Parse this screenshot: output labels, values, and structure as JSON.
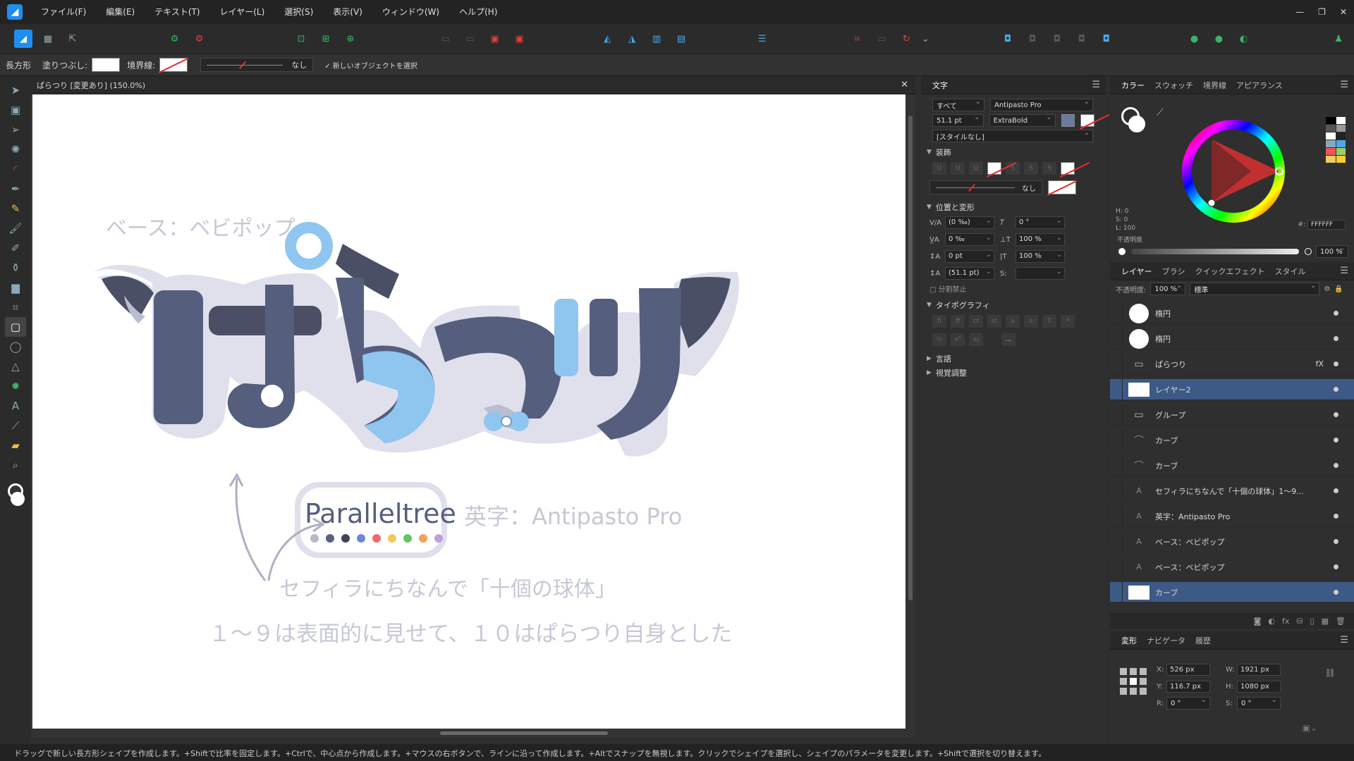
{
  "menu": {
    "items": [
      "ファイル(F)",
      "編集(E)",
      "テキスト(T)",
      "レイヤー(L)",
      "選択(S)",
      "表示(V)",
      "ウィンドウ(W)",
      "ヘルプ(H)"
    ],
    "window_controls": [
      "—",
      "❐",
      "✕"
    ]
  },
  "context_bar": {
    "tool_name": "長方形",
    "fill_label": "塗りつぶし:",
    "stroke_label": "境界線:",
    "stroke_style": "なし",
    "select_new_label": "新しいオブジェクトを選択"
  },
  "document": {
    "tab_title": "ぱらつり [変更あり] (150.0%)"
  },
  "artwork": {
    "base_font_note": "ベース：ベビポップ",
    "logo_text": "ぱらつり",
    "sublogo": "Paralleltree",
    "english_font_note": "英字：Antipasto Pro",
    "note_line1": "セフィラにちなんで「十個の球体」",
    "note_line2": "１～９は表面的に見せて、１０はぱらつり自身とした",
    "dot_colors": [
      "#b8b8cc",
      "#5a6080",
      "#3f4358",
      "#6e86d8",
      "#ef6b6b",
      "#f2c85a",
      "#66c466",
      "#f2a25a",
      "#c49be0"
    ],
    "logo_dark": "#565e7e",
    "logo_light": "#8ec6ef",
    "outline": "#dfe0ec"
  },
  "character_panel": {
    "title": "文字",
    "scope": "すべて",
    "font_family": "Antipasto Pro",
    "font_size": "51.1 pt",
    "font_weight": "ExtraBold",
    "style": "[スタイルなし]",
    "decoration_section": "装飾",
    "decoration_line": "なし",
    "position_section": "位置と変形",
    "kerning": "(0 ‰)",
    "tracking": "0 ‰",
    "baseline": "0 pt",
    "leading": "(51.1 pt)",
    "shear": "0 °",
    "scale_v": "100 %",
    "scale_h": "100 %",
    "no_break": "分割禁止",
    "typography_section": "タイポグラフィ",
    "more_btn": "...",
    "language_section": "言語",
    "visual_section": "視覚調整"
  },
  "color_panel": {
    "tabs": [
      "カラー",
      "スウォッチ",
      "境界線",
      "アピアランス"
    ],
    "h": "H: 0",
    "s": "S: 0",
    "l": "L: 100",
    "hex_label": "#:",
    "hex": "FFFFFF",
    "opacity_label": "不透明度",
    "opacity": "100 %"
  },
  "layers_panel": {
    "tabs": [
      "レイヤー",
      "ブラシ",
      "クイックエフェクト",
      "スタイル"
    ],
    "opacity_label": "不透明度:",
    "opacity": "100 %",
    "blend": "標準",
    "layers": [
      {
        "name": "楕円",
        "kind": "ellipse",
        "selected": false
      },
      {
        "name": "楕円",
        "kind": "ellipse",
        "selected": false
      },
      {
        "name": "ぱらつり",
        "kind": "folder",
        "selected": false,
        "fx": "fX"
      },
      {
        "name": "レイヤー2",
        "kind": "rect",
        "selected": true
      },
      {
        "name": "グループ",
        "kind": "folder",
        "selected": false
      },
      {
        "name": "カーブ",
        "kind": "curve",
        "selected": false
      },
      {
        "name": "カーブ",
        "kind": "curve",
        "selected": false
      },
      {
        "name": "セフィラにちなんで「十個の球体」1～9...",
        "kind": "text",
        "selected": false
      },
      {
        "name": "英字：Antipasto Pro",
        "kind": "text",
        "selected": false
      },
      {
        "name": "ベース：ベビポップ",
        "kind": "text",
        "selected": false
      },
      {
        "name": "ベース：ベビポップ",
        "kind": "text",
        "selected": false
      },
      {
        "name": "カーブ",
        "kind": "rect",
        "selected": true
      }
    ]
  },
  "transform_panel": {
    "tabs": [
      "変形",
      "ナビゲータ",
      "履歴"
    ],
    "x_label": "X:",
    "x": "526 px",
    "y_label": "Y:",
    "y": "116.7 px",
    "w_label": "W:",
    "w": "1921 px",
    "h_label": "H:",
    "h": "1080 px",
    "r_label": "R:",
    "r": "0 °",
    "s_label": "S:",
    "s": "0 °"
  },
  "status": {
    "hint": "ドラッグで新しい長方形シェイプを作成します。+Shiftで比率を固定します。+Ctrlで、中心点から作成します。+マウスの右ボタンで、ラインに沿って作成します。+Altでスナップを無視します。クリックでシェイプを選択し、シェイプのパラメータを変更します。+Shiftで選択を切り替えます。"
  }
}
